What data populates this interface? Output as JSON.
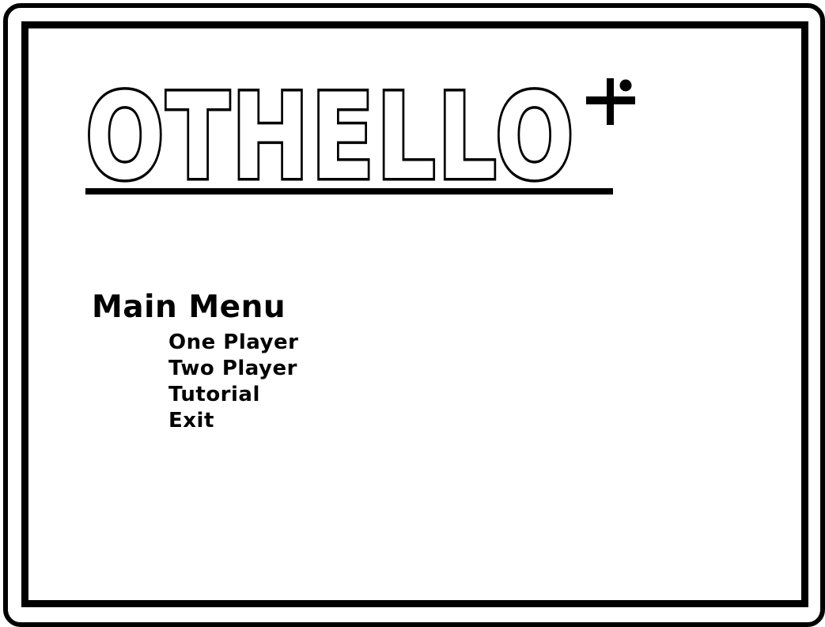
{
  "title": {
    "text": "OTHELLO",
    "suffix_symbol": "+"
  },
  "menu": {
    "heading": "Main Menu",
    "items": [
      {
        "label": "One Player"
      },
      {
        "label": "Two Player"
      },
      {
        "label": "Tutorial"
      },
      {
        "label": "Exit"
      }
    ]
  },
  "colors": {
    "foreground": "#000000",
    "background": "#ffffff"
  }
}
